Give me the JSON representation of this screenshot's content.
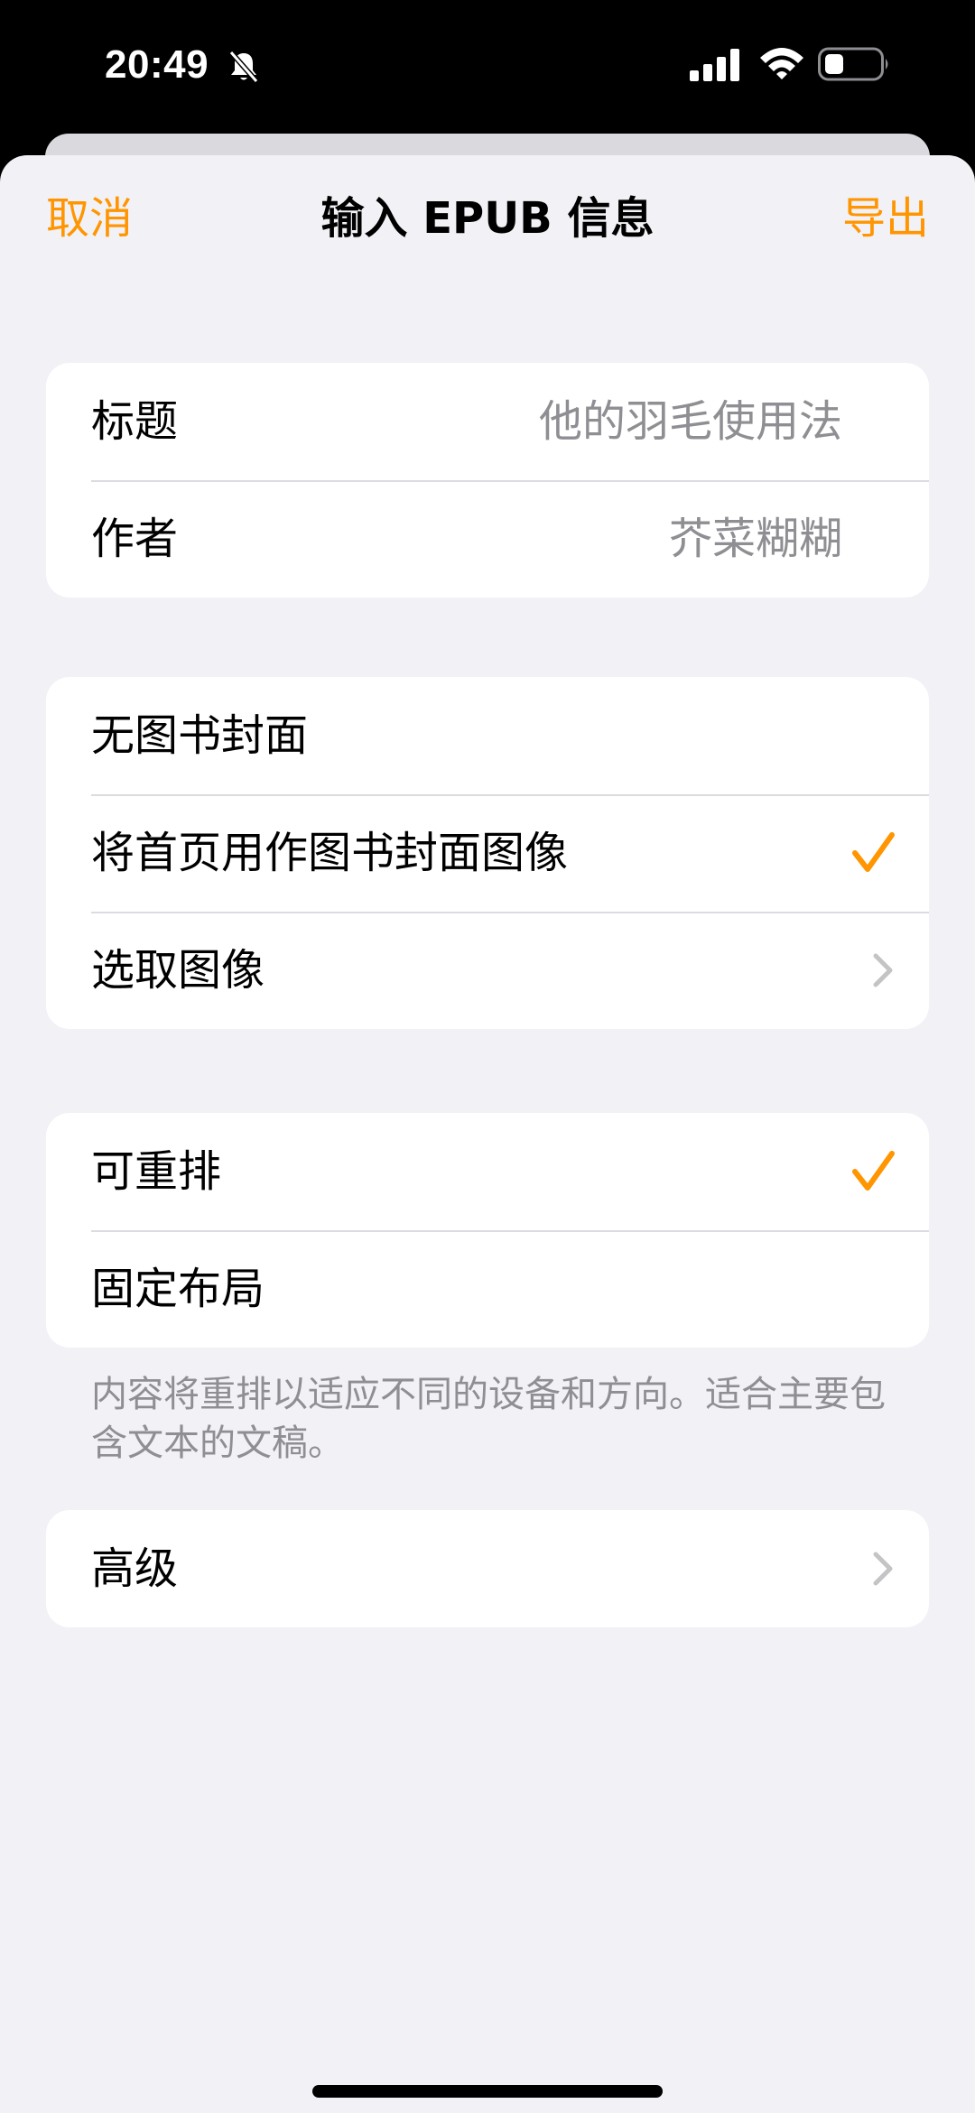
{
  "status_bar": {
    "time": "20:49",
    "icons": [
      "bell-slash-icon",
      "cellular-signal-icon",
      "wifi-icon",
      "battery-icon"
    ]
  },
  "colors": {
    "accent": "#ff9500",
    "background": "#f1f1f6",
    "secondary_text": "#8e8e93"
  },
  "nav": {
    "cancel_label": "取消",
    "title": "输入 EPUB 信息",
    "export_label": "导出"
  },
  "metadata": {
    "title_label": "标题",
    "title_value": "他的羽毛使用法",
    "author_label": "作者",
    "author_value": "芥菜糊糊"
  },
  "cover": {
    "items": [
      {
        "label": "无图书封面",
        "selected": false
      },
      {
        "label": "将首页用作图书封面图像",
        "selected": true
      },
      {
        "label": "选取图像",
        "disclosure": true
      }
    ]
  },
  "layout": {
    "items": [
      {
        "label": "可重排",
        "selected": true
      },
      {
        "label": "固定布局",
        "selected": false
      }
    ],
    "footer": "内容将重排以适应不同的设备和方向。适合主要包含文本的文稿。"
  },
  "advanced": {
    "label": "高级"
  }
}
